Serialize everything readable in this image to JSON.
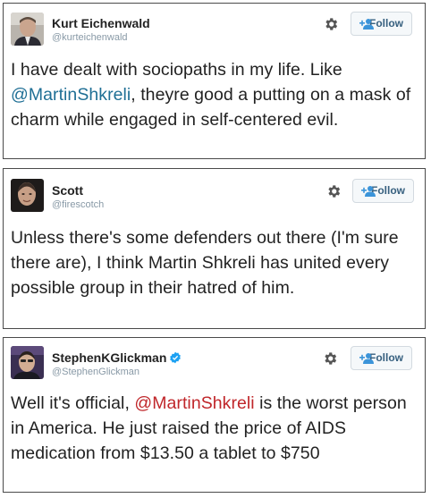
{
  "tweets": [
    {
      "name": "Kurt Eichenwald",
      "handle": "@kurteichenwald",
      "verified": false,
      "follow_label": "Follow",
      "text_before": "I have dealt with sociopaths in my life. Like ",
      "mention": "@MartinShkreli",
      "text_after": ", theyre good a putting on a mask of charm while engaged in self-centered evil."
    },
    {
      "name": "Scott",
      "handle": "@firescotch",
      "verified": false,
      "follow_label": "Follow",
      "text": "Unless there's some defenders out there (I'm sure there are), I think Martin Shkreli has united every possible group in their hatred of him."
    },
    {
      "name": "StephenKGlickman",
      "handle": "@StephenGlickman",
      "verified": true,
      "follow_label": "Follow",
      "text_before": "Well it's official, ",
      "mention": "@MartinShkreli",
      "text_after": " is the worst person in America. He just raised the price of AIDS medication from $13.50 a tablet to $750"
    }
  ],
  "colors": {
    "mention_blue": "#1f6f95",
    "mention_red": "#c0262a",
    "follow_text": "#37607f",
    "handle_gray": "#8899a6",
    "verified_blue": "#1da1f2"
  },
  "icons": [
    "gear-icon",
    "follow-person-icon",
    "verified-badge-icon"
  ]
}
